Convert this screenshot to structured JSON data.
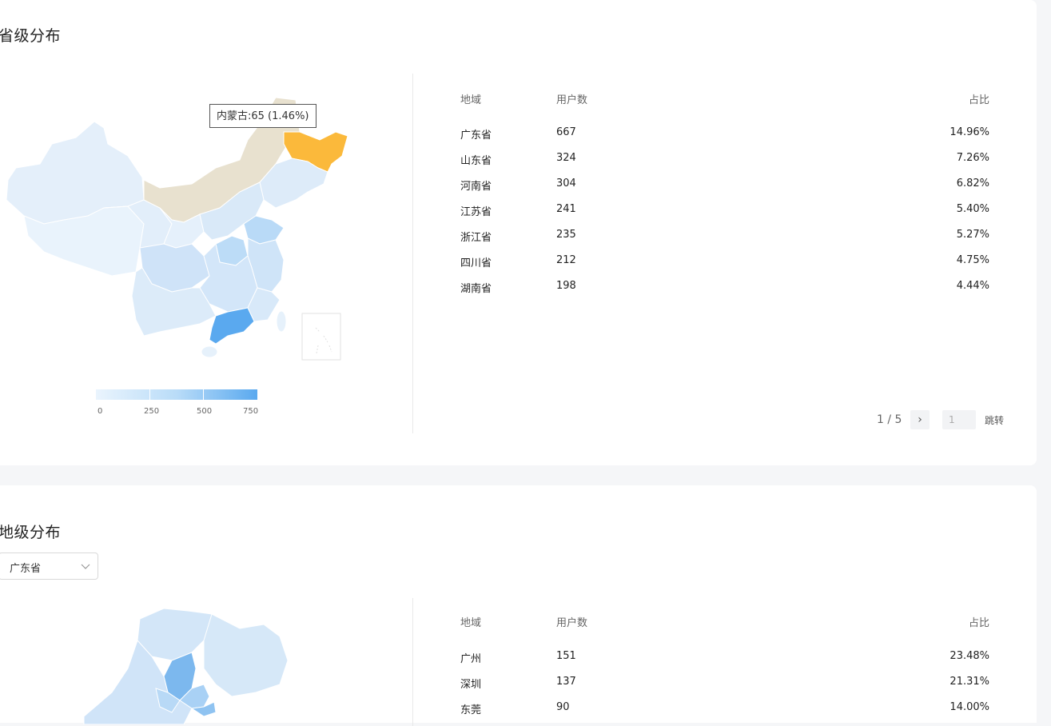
{
  "province_section": {
    "title": "省级分布",
    "tooltip": "内蒙古:65 (1.46%)",
    "legend": {
      "labels": [
        "0",
        "250",
        "500",
        "750"
      ]
    },
    "table": {
      "headers": {
        "region": "地域",
        "users": "用户数",
        "ratio": "占比"
      },
      "rows": [
        {
          "region": "广东省",
          "users": "667",
          "ratio": "14.96%"
        },
        {
          "region": "山东省",
          "users": "324",
          "ratio": "7.26%"
        },
        {
          "region": "河南省",
          "users": "304",
          "ratio": "6.82%"
        },
        {
          "region": "江苏省",
          "users": "241",
          "ratio": "5.40%"
        },
        {
          "region": "浙江省",
          "users": "235",
          "ratio": "5.27%"
        },
        {
          "region": "四川省",
          "users": "212",
          "ratio": "4.75%"
        },
        {
          "region": "湖南省",
          "users": "198",
          "ratio": "4.44%"
        }
      ]
    },
    "pager": {
      "current": "1",
      "separator": "/",
      "total": "5",
      "next_icon": "›",
      "input_value": "1",
      "jump_label": "跳转"
    }
  },
  "city_section": {
    "title": "地级分布",
    "select": {
      "selected": "广东省"
    },
    "table": {
      "headers": {
        "region": "地域",
        "users": "用户数",
        "ratio": "占比"
      },
      "rows": [
        {
          "region": "广州",
          "users": "151",
          "ratio": "23.48%"
        },
        {
          "region": "深圳",
          "users": "137",
          "ratio": "21.31%"
        },
        {
          "region": "东莞",
          "users": "90",
          "ratio": "14.00%"
        }
      ]
    }
  },
  "colors": {
    "highlight": "#fbb93b",
    "hover": "#e8e1cf",
    "max": "#5aa9ef",
    "low": "#e8f2fc",
    "pager_current": "#22b05a"
  }
}
